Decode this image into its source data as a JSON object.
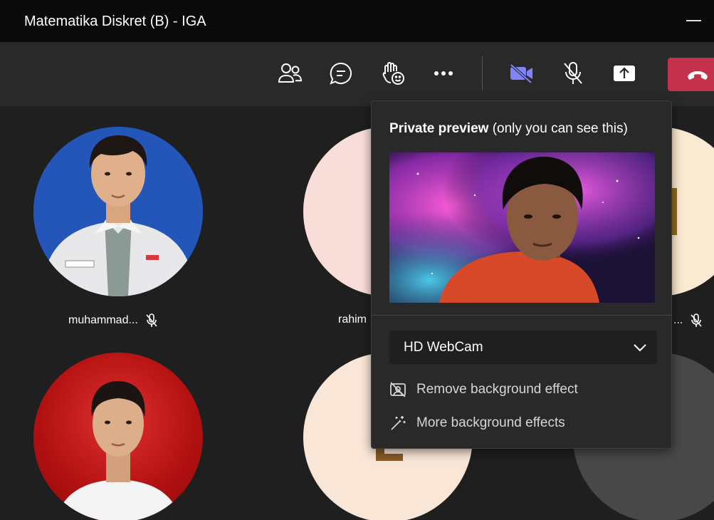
{
  "window": {
    "title": "Matematika Diskret (B) - IGA"
  },
  "toolbar": {
    "buttons": [
      {
        "icon": "people-icon"
      },
      {
        "icon": "chat-icon"
      },
      {
        "icon": "raise-hand-icon"
      },
      {
        "icon": "more-icon"
      },
      {
        "icon": "camera-off-icon",
        "color": "#7f85f5"
      },
      {
        "icon": "mic-off-icon"
      },
      {
        "icon": "share-icon"
      },
      {
        "icon": "hang-up-icon",
        "color": "#c4314b"
      }
    ]
  },
  "participants": [
    {
      "name": "muhammad...",
      "muted": true
    },
    {
      "name": "rahim",
      "muted": false
    },
    {
      "name": "...",
      "muted": true
    },
    {
      "name": "",
      "muted": false
    },
    {
      "name": "",
      "muted": false
    },
    {
      "name": "",
      "muted": false
    }
  ],
  "popup": {
    "heading_bold": "Private preview",
    "heading_rest": " (only you can see this)",
    "camera": "HD WebCam",
    "remove_bg": "Remove background effect",
    "more_bg": "More background effects"
  },
  "colors": {
    "accent": "#7f85f5",
    "hangup": "#c4314b",
    "popup_bg": "#292929"
  }
}
